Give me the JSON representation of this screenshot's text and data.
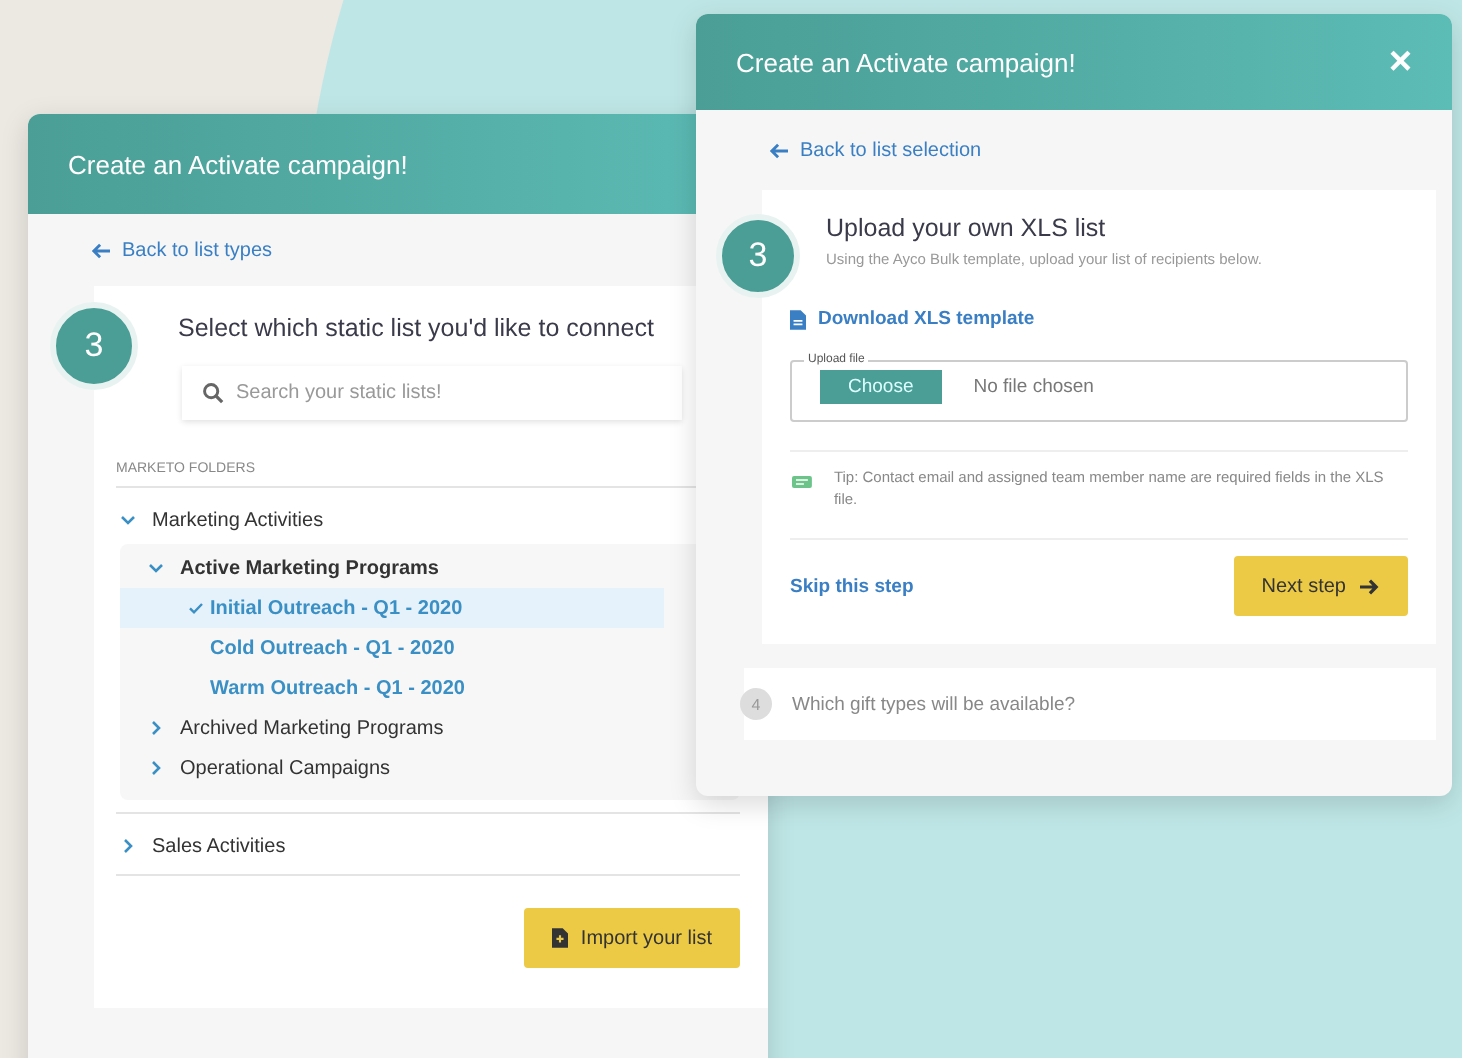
{
  "left_window": {
    "title": "Create an Activate campaign!",
    "back_link": "Back to list types",
    "step_number": "3",
    "step_title": "Select which static list you'd like to connect",
    "search": {
      "placeholder": "Search your static lists!"
    },
    "folders_heading": "MARKETO FOLDERS",
    "tree": [
      {
        "kind": "folder",
        "label": "Marketing Activities",
        "expanded": true,
        "children": [
          {
            "kind": "folder",
            "label": "Active Marketing Programs",
            "expanded": true,
            "children": [
              {
                "kind": "list",
                "label": "Initial Outreach - Q1 - 2020",
                "selected": true
              },
              {
                "kind": "list",
                "label": "Cold Outreach - Q1 - 2020",
                "selected": false
              },
              {
                "kind": "list",
                "label": "Warm Outreach - Q1 - 2020",
                "selected": false
              }
            ]
          },
          {
            "kind": "folder",
            "label": "Archived Marketing Programs",
            "expanded": false
          },
          {
            "kind": "folder",
            "label": "Operational Campaigns",
            "expanded": false
          }
        ]
      },
      {
        "kind": "folder",
        "label": "Sales Activities",
        "expanded": false
      }
    ],
    "import_button": "Import your list"
  },
  "right_window": {
    "title": "Create an Activate campaign!",
    "close_button": "×",
    "back_link": "Back to list selection",
    "step_number": "3",
    "step_title": "Upload your own XLS list",
    "step_subtitle": "Using the Ayco Bulk template, upload your list of recipients below.",
    "download_link": "Download XLS template",
    "upload": {
      "legend": "Upload file",
      "choose_button": "Choose",
      "value": "No file chosen"
    },
    "tip": "Tip: Contact email and assigned team member name are required fields in the XLS file.",
    "skip_link": "Skip this step",
    "next_button": "Next step",
    "next_step_number": "4",
    "next_step_title": "Which gift types will be available?"
  }
}
